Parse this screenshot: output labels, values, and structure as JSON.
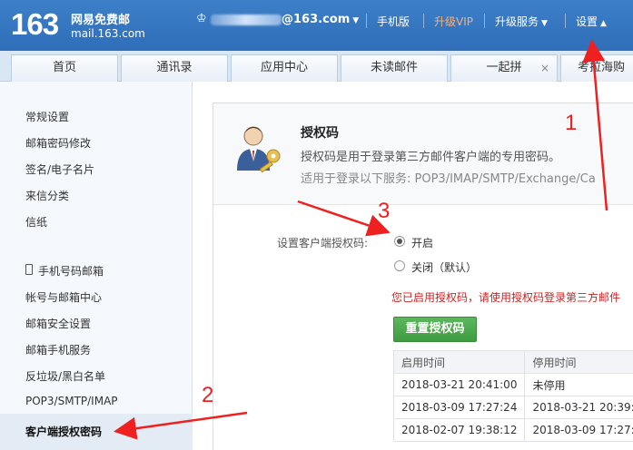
{
  "header": {
    "logo_number": "163",
    "logo_name": "网易免费邮",
    "logo_domain": "mail.163.com",
    "user_email_domain": "@163.com",
    "links": [
      {
        "label": "手机版"
      },
      {
        "label": "升级VIP"
      },
      {
        "label": "升级服务"
      },
      {
        "label": "设置"
      }
    ]
  },
  "tabs": [
    {
      "label": "首页"
    },
    {
      "label": "通讯录"
    },
    {
      "label": "应用中心"
    },
    {
      "label": "未读邮件"
    },
    {
      "label": "一起拼",
      "close": "×"
    },
    {
      "label": "考拉海购"
    }
  ],
  "sidebar": {
    "items": [
      "常规设置",
      "邮箱密码修改",
      "签名/电子名片",
      "来信分类",
      "信纸",
      "手机号码邮箱",
      "帐号与邮箱中心",
      "邮箱安全设置",
      "邮箱手机服务",
      "反垃圾/黑白名单",
      "POP3/SMTP/IMAP",
      "客户端授权密码"
    ]
  },
  "auth": {
    "title": "授权码",
    "desc": "授权码是用于登录第三方邮件客户端的专用密码。",
    "services": "适用于登录以下服务: POP3/IMAP/SMTP/Exchange/Ca",
    "setting_label": "设置客户端授权码:",
    "option_on": "开启",
    "option_off": "关闭（默认）",
    "warning": "您已启用授权码，请使用授权码登录第三方邮件",
    "reset_button": "重置授权码",
    "table": {
      "headers": [
        "启用时间",
        "停用时间"
      ],
      "rows": [
        [
          "2018-03-21 20:41:00",
          "未停用"
        ],
        [
          "2018-03-09 17:27:24",
          "2018-03-21 20:39:"
        ],
        [
          "2018-02-07 19:38:12",
          "2018-03-09 17:27:"
        ]
      ]
    }
  },
  "annotations": {
    "step1": "1",
    "step2": "2",
    "step3": "3"
  },
  "colors": {
    "header_blue": "#2f6eb8",
    "vip_orange": "#ffb070",
    "warning_red": "#cc2222",
    "button_green": "#4cae4c",
    "annotation_red": "#ee2020"
  }
}
